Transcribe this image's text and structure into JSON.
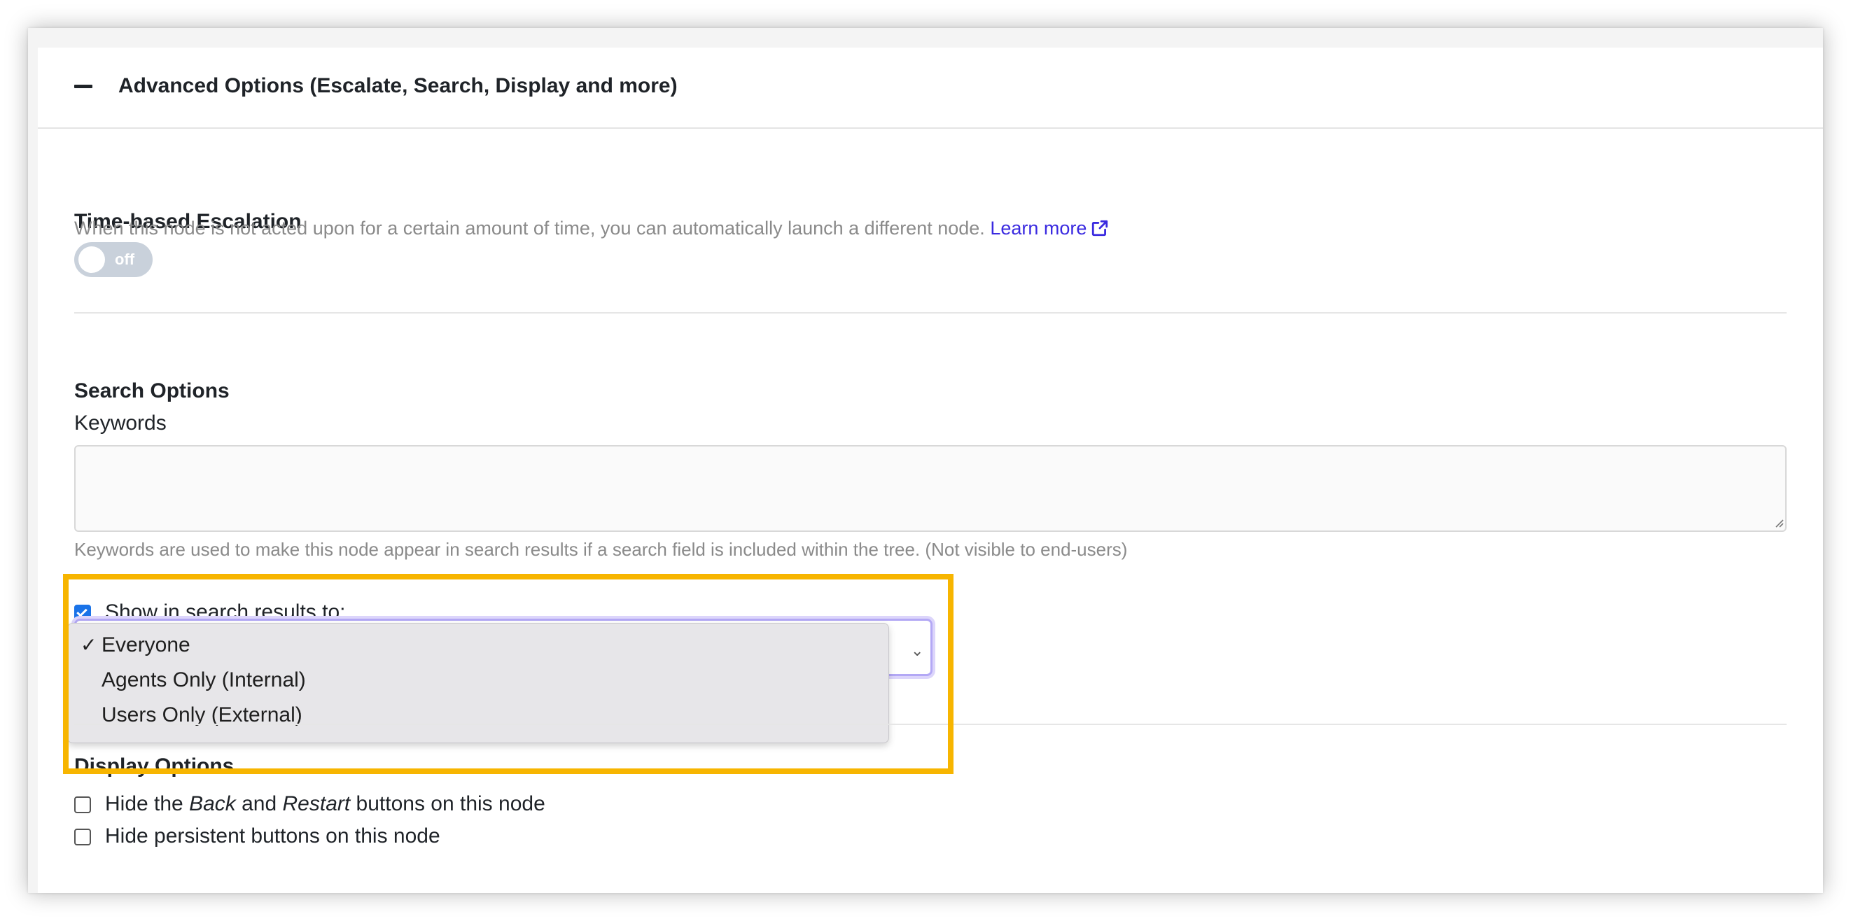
{
  "header": {
    "title": "Advanced Options (Escalate, Search, Display and more)"
  },
  "escalation": {
    "title": "Time-based Escalation",
    "description": "When this node is not acted upon for a certain amount of time, you can automatically launch a different node.",
    "learn_more": "Learn more",
    "toggle_label": "off",
    "toggle_state": false
  },
  "search": {
    "title": "Search Options",
    "keywords_label": "Keywords",
    "keywords_value": "",
    "help_text": "Keywords are used to make this node appear in search results if a search field is included within the tree. (Not visible to end-users)",
    "show_in_results_label": "Show in search results to:",
    "show_in_results_checked": true,
    "options": [
      {
        "label": "Everyone",
        "selected": true
      },
      {
        "label": "Agents Only (Internal)",
        "selected": false
      },
      {
        "label": "Users Only (External)",
        "selected": false
      }
    ],
    "check_glyph": "✓"
  },
  "display": {
    "title": "Display Options",
    "hide_back_restart": {
      "prefix": "Hide the ",
      "back": "Back",
      "and": " and ",
      "restart": "Restart",
      "suffix": " buttons on this node",
      "checked": false
    },
    "hide_persistent": {
      "label": "Hide persistent buttons on this node",
      "checked": false
    }
  },
  "colors": {
    "link": "#3a2ae0",
    "highlight": "#f7b500",
    "checkbox": "#1a73e8",
    "toggle_off": "#c9d1db"
  }
}
